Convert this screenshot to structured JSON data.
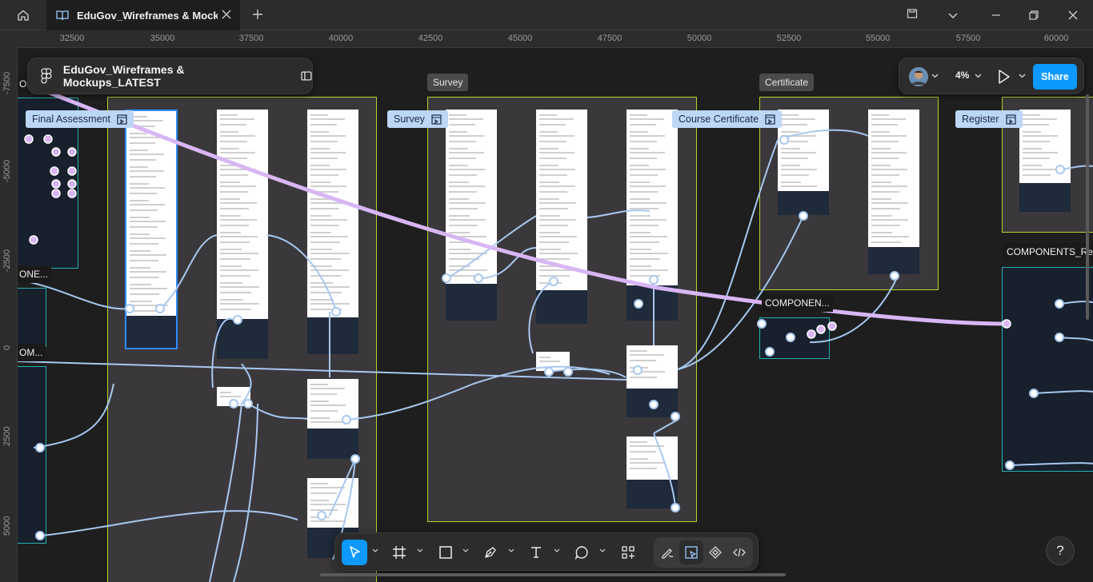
{
  "tab": {
    "title": "EduGov_Wireframes & Mockups_LATEST"
  },
  "file": {
    "name": "EduGov_Wireframes & Mockups_LATEST"
  },
  "zoom": {
    "level": "4%"
  },
  "share": {
    "label": "Share"
  },
  "ruler": {
    "top": [
      "32500",
      "35000",
      "37500",
      "40000",
      "42500",
      "45000",
      "47500",
      "50000",
      "52500",
      "55000",
      "57500",
      "60000"
    ],
    "left": [
      "-7500",
      "-5000",
      "-2500",
      "0",
      "2500",
      "5000"
    ]
  },
  "sections": {
    "survey_title": "Survey",
    "certificate_title": "Certificate"
  },
  "chips": {
    "final_assessment": "Final Assessment",
    "survey": "Survey",
    "course_certificate": "Course Certificate",
    "register": "Register"
  },
  "labels": {
    "components_1": "COMPONEN...",
    "components_2": "COMPONENTS_Regi",
    "left_om_top": "OM",
    "left_onent": "ONE...",
    "left_om_bottom": "OM..."
  },
  "toolbar": {
    "tools": [
      "move-tool",
      "frame-tool",
      "rectangle-tool",
      "pen-tool",
      "text-tool",
      "comment-tool",
      "actions-tool"
    ],
    "modes": [
      "draw-mode",
      "design-mode",
      "dev-components-mode",
      "dev-mode"
    ]
  },
  "help": {
    "label": "?"
  },
  "colors": {
    "accent": "#0d99ff",
    "section_border": "#b6d42c",
    "connector": "#a7c8ef",
    "flow_highlight": "#d8b6f5"
  }
}
